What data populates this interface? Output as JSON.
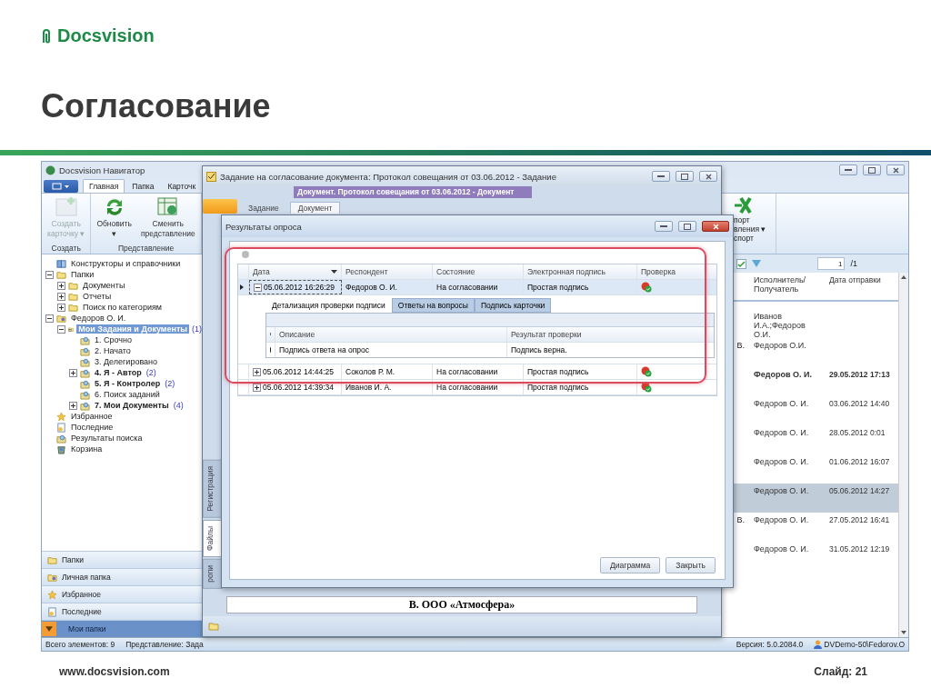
{
  "slide": {
    "logo": "Docsvision",
    "title": "Согласование",
    "footer_url": "www.docsvision.com",
    "slide_number": "Слайд: 21"
  },
  "navigator": {
    "title": "Docsvision Навигатор",
    "ribbon_tabs": [
      {
        "label": "Главная",
        "selected": true
      },
      {
        "label": "Папка",
        "selected": false
      },
      {
        "label": "Карточк",
        "selected": false
      }
    ],
    "ribbon_groups": [
      {
        "label": "Создать",
        "buttons": [
          {
            "lines": [
              "Создать",
              "карточку ▾"
            ],
            "disabled": true
          }
        ]
      },
      {
        "label": "Представление",
        "buttons": [
          {
            "lines": [
              "Обновить",
              "▾"
            ],
            "disabled": false
          },
          {
            "lines": [
              "Сменить",
              "представление"
            ],
            "disabled": false
          }
        ]
      }
    ],
    "ribbon_export": {
      "lines": [
        "порт",
        "вления ▾"
      ],
      "group": "спорт"
    },
    "tree": [
      {
        "label": "Конструкторы и справочники",
        "kind": "book",
        "bold": false,
        "selected": false
      },
      {
        "label": "Папки",
        "kind": "folder",
        "expanded": true,
        "bold": false,
        "selected": false,
        "children": [
          {
            "label": "Документы",
            "kind": "folder",
            "expanded": false,
            "bold": false,
            "selected": false
          },
          {
            "label": "Отчеты",
            "kind": "folder",
            "expanded": false,
            "bold": false,
            "selected": false
          },
          {
            "label": "Поиск по категориям",
            "kind": "folder",
            "expanded": false,
            "bold": false,
            "selected": false
          }
        ]
      },
      {
        "label": "Федоров О. И.",
        "kind": "user-folder",
        "expanded": true,
        "bold": false,
        "selected": false,
        "children": [
          {
            "label": "Мои Задания и Документы",
            "count": "(1)",
            "kind": "task-folder",
            "expanded": true,
            "bold": true,
            "selected": true,
            "children": [
              {
                "label": "1. Срочно",
                "kind": "query",
                "bold": false,
                "selected": false
              },
              {
                "label": "2. Начато",
                "kind": "query",
                "bold": false,
                "selected": false
              },
              {
                "label": "3. Делегировано",
                "kind": "query",
                "bold": false,
                "selected": false
              },
              {
                "label": "4. Я - Автор",
                "count": "(2)",
                "kind": "query",
                "expanded": false,
                "bold": true,
                "selected": false
              },
              {
                "label": "5. Я - Контролер",
                "count": "(2)",
                "kind": "query",
                "bold": true,
                "selected": false
              },
              {
                "label": "6. Поиск заданий",
                "kind": "query",
                "bold": false,
                "selected": false
              },
              {
                "label": "7. Мои Документы",
                "count": "(4)",
                "kind": "query",
                "expanded": false,
                "bold": true,
                "selected": false
              }
            ]
          }
        ]
      },
      {
        "label": "Избранное",
        "kind": "star",
        "bold": false,
        "selected": false
      },
      {
        "label": "Последние",
        "kind": "recent",
        "bold": false,
        "selected": false
      },
      {
        "label": "Результаты поиска",
        "kind": "query",
        "bold": false,
        "selected": false
      },
      {
        "label": "Корзина",
        "kind": "trash",
        "bold": false,
        "selected": false
      }
    ],
    "nav_buttons": [
      {
        "label": "Папки",
        "kind": "folder",
        "selected": false
      },
      {
        "label": "Личная папка",
        "kind": "user-folder",
        "selected": false
      },
      {
        "label": "Избранное",
        "kind": "star",
        "selected": false
      },
      {
        "label": "Последние",
        "kind": "recent",
        "selected": false
      },
      {
        "label": "Мои папки",
        "kind": "arrow",
        "selected": true
      }
    ],
    "list": {
      "page": "1",
      "page_total": "/1",
      "columns": [
        "Исполнитель/ Получатель",
        "Дата отправки"
      ],
      "rows": [
        {
          "executor": "Иванов И.А.;Федоров О.И.",
          "bold": false,
          "selected": false
        },
        {
          "fragment": "В.",
          "executor": "Федоров О.И.",
          "bold": false,
          "selected": false
        },
        {
          "executor": "Федоров О. И.",
          "date": "29.05.2012 17:13",
          "bold": true,
          "selected": false
        },
        {
          "executor": "Федоров О. И.",
          "date": "03.06.2012 14:40",
          "bold": false,
          "selected": false
        },
        {
          "executor": "Федоров О. И.",
          "date": "28.05.2012 0:01",
          "bold": false,
          "selected": false
        },
        {
          "executor": "Федоров О. И.",
          "date": "01.06.2012 16:07",
          "bold": false,
          "selected": false
        },
        {
          "executor": "Федоров О. И.",
          "date": "05.06.2012 14:27",
          "bold": false,
          "selected": true
        },
        {
          "fragment": "В.",
          "executor": "Федоров О. И.",
          "date": "27.05.2012 16:41",
          "bold": false,
          "selected": false
        },
        {
          "executor": "Федоров О. И.",
          "date": "31.05.2012 12:19",
          "bold": false,
          "selected": false
        }
      ]
    },
    "status": {
      "count": "Всего элементов: 9",
      "view": "Представление: Зада",
      "version": "Версия: 5.0.2084.0",
      "user": "DVDemo-50\\Fedorov.O"
    }
  },
  "task_window": {
    "title": "Задание на согласование документа: Протокол совещания от 03.06.2012 - Задание",
    "document_header": "Документ. Протокол совещания от 03.06.2012 - Документ",
    "tabs": [
      {
        "label": "Задание",
        "selected": false
      },
      {
        "label": "Документ",
        "selected": true
      }
    ],
    "side_tabs": [
      {
        "label": "Регистрация",
        "selected": false
      },
      {
        "label": "Файлы",
        "selected": true
      },
      {
        "label": "ропи",
        "selected": false
      }
    ],
    "document_text": "В. ООО «Атмосфера»"
  },
  "dialog": {
    "title": "Результаты опроса",
    "columns": [
      {
        "label": "Дата",
        "sorted": true
      },
      {
        "label": "Респондент",
        "sorted": false
      },
      {
        "label": "Состояние",
        "sorted": false
      },
      {
        "label": "Электронная подпись",
        "sorted": false
      },
      {
        "label": "Проверка",
        "sorted": false
      }
    ],
    "rows": [
      {
        "date": "05.06.2012 16:26:29",
        "respondent": "Федоров О. И.",
        "state": "На согласовании",
        "signature": "Простая подпись",
        "expanded": true,
        "selected": true
      },
      {
        "date": "05.06.2012 14:44:25",
        "respondent": "Соколов Р. М.",
        "state": "На согласовании",
        "signature": "Простая подпись",
        "expanded": false,
        "selected": false
      },
      {
        "date": "05.06.2012 14:39:34",
        "respondent": "Иванов И. А.",
        "state": "На согласовании",
        "signature": "Простая подпись",
        "expanded": false,
        "selected": false
      }
    ],
    "detail": {
      "tabs": [
        {
          "label": "Детализация проверки подписи",
          "selected": true
        },
        {
          "label": "Ответы на вопросы",
          "selected": false
        },
        {
          "label": "Подпись карточки",
          "selected": false
        }
      ],
      "columns": [
        "Описание",
        "Результат проверки"
      ],
      "rows": [
        {
          "description": "Подпись ответа на опрос",
          "result": "Подпись верна."
        }
      ]
    },
    "buttons": [
      "Диаграмма",
      "Закрыть"
    ]
  }
}
